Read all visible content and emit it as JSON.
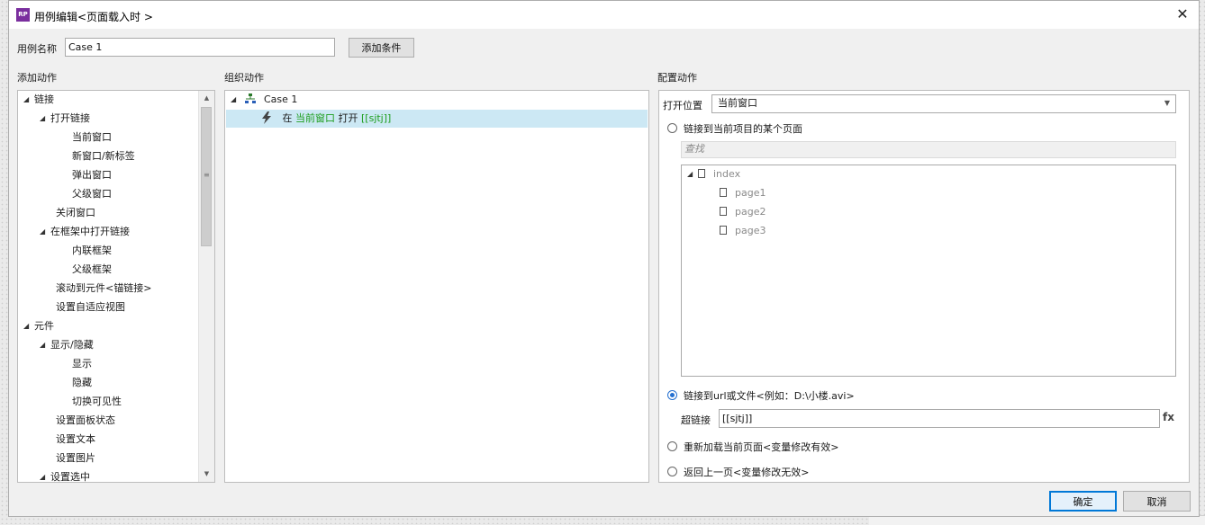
{
  "window": {
    "title": "用例编辑<页面载入时 >",
    "app_icon_text": "RP",
    "close_glyph": "✕"
  },
  "case_name": {
    "label": "用例名称",
    "value": "Case 1",
    "add_condition_label": "添加条件"
  },
  "add_actions": {
    "header": "添加动作",
    "items": [
      {
        "label": "链接",
        "expanded": true
      },
      {
        "label": "打开链接",
        "expanded": true
      },
      {
        "label": "当前窗口"
      },
      {
        "label": "新窗口/新标签"
      },
      {
        "label": "弹出窗口"
      },
      {
        "label": "父级窗口"
      },
      {
        "label": "关闭窗口"
      },
      {
        "label": "在框架中打开链接",
        "expanded": true
      },
      {
        "label": "内联框架"
      },
      {
        "label": "父级框架"
      },
      {
        "label": "滚动到元件<锚链接>"
      },
      {
        "label": "设置自适应视图"
      },
      {
        "label": "元件",
        "expanded": true
      },
      {
        "label": "显示/隐藏",
        "expanded": true
      },
      {
        "label": "显示"
      },
      {
        "label": "隐藏"
      },
      {
        "label": "切换可见性"
      },
      {
        "label": "设置面板状态"
      },
      {
        "label": "设置文本"
      },
      {
        "label": "设置图片"
      },
      {
        "label": "设置选中",
        "expanded": true
      }
    ]
  },
  "organize_actions": {
    "header": "组织动作",
    "case_label": "Case 1",
    "action": {
      "prefix": "在",
      "target": "当前窗口",
      "verb": "打开",
      "link": "[[sjtj]]"
    }
  },
  "config_actions": {
    "header": "配置动作",
    "open_location_label": "打开位置",
    "open_location_value": "当前窗口",
    "option_page": "链接到当前项目的某个页面",
    "search_placeholder": "查找",
    "pages": [
      "index",
      "page1",
      "page2",
      "page3"
    ],
    "option_url": "链接到url或文件<例如：D:\\小楼.avi>",
    "hyperlink_label": "超链接",
    "hyperlink_value": "[[sjtj]]",
    "fx_label": "fx",
    "option_reload": "重新加载当前页面<变量修改有效>",
    "option_back": "返回上一页<变量修改无效>",
    "selected_option": "url"
  },
  "footer": {
    "ok_label": "确定",
    "cancel_label": "取消"
  },
  "colors": {
    "selection": "#cce8f4",
    "accent": "#0078d7",
    "variable_green": "#1e9e1e",
    "app_icon": "#7a2e9e"
  }
}
